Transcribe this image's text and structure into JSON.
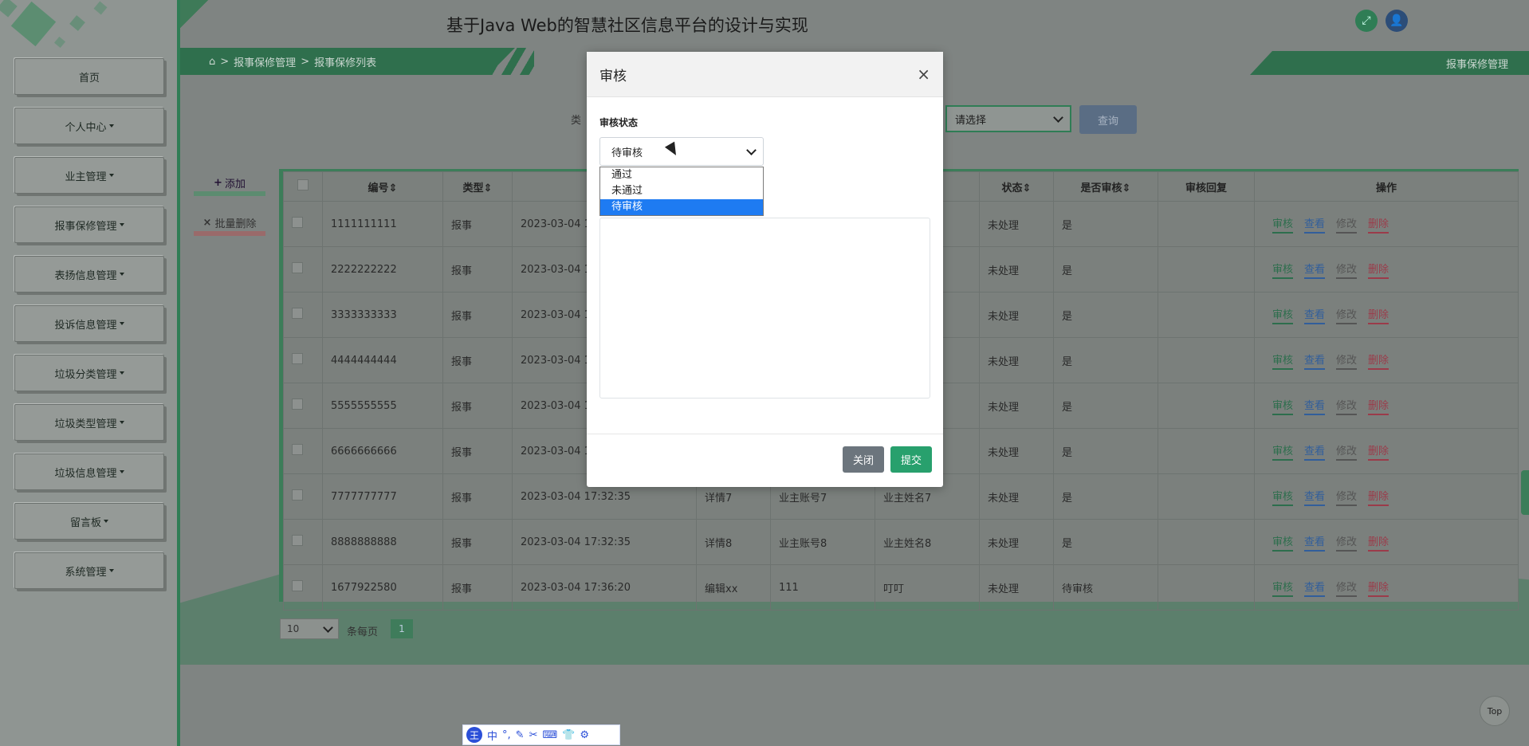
{
  "app": {
    "title": "基于Java Web的智慧社区信息平台的设计与实现"
  },
  "sidebar": {
    "items": [
      {
        "label": "首页",
        "has_caret": false
      },
      {
        "label": "个人中心",
        "has_caret": true
      },
      {
        "label": "业主管理",
        "has_caret": true
      },
      {
        "label": "报事保修管理",
        "has_caret": true
      },
      {
        "label": "表扬信息管理",
        "has_caret": true
      },
      {
        "label": "投诉信息管理",
        "has_caret": true
      },
      {
        "label": "垃圾分类管理",
        "has_caret": true
      },
      {
        "label": "垃圾类型管理",
        "has_caret": true
      },
      {
        "label": "垃圾信息管理",
        "has_caret": true
      },
      {
        "label": "留言板",
        "has_caret": true
      },
      {
        "label": "系统管理",
        "has_caret": true
      }
    ]
  },
  "breadcrumb": {
    "home_icon": "home-icon",
    "items": [
      "报事保修管理",
      "报事保修列表"
    ],
    "separator": ">"
  },
  "right_tab": "报事保修管理",
  "search": {
    "label": "类",
    "select_value": "请选择",
    "query_label": "查询"
  },
  "actions": {
    "add_label": "添加",
    "batch_delete_label": "批量删除"
  },
  "table": {
    "headers": [
      "编号",
      "类型",
      "",
      "",
      "",
      "",
      "状态",
      "是否审核",
      "审核回复",
      "操作"
    ],
    "rows": [
      {
        "id": "1111111111",
        "type": "报事",
        "time": "2023-03-04 17:",
        "detail": "",
        "account": "",
        "name": "",
        "status": "未处理",
        "audited": "是"
      },
      {
        "id": "2222222222",
        "type": "报事",
        "time": "2023-03-04 17:",
        "detail": "",
        "account": "",
        "name": "",
        "status": "未处理",
        "audited": "是"
      },
      {
        "id": "3333333333",
        "type": "报事",
        "time": "2023-03-04 17:",
        "detail": "",
        "account": "",
        "name": "",
        "status": "未处理",
        "audited": "是"
      },
      {
        "id": "4444444444",
        "type": "报事",
        "time": "2023-03-04 17:",
        "detail": "",
        "account": "",
        "name": "",
        "status": "未处理",
        "audited": "是"
      },
      {
        "id": "5555555555",
        "type": "报事",
        "time": "2023-03-04 17:",
        "detail": "",
        "account": "",
        "name": "",
        "status": "未处理",
        "audited": "是"
      },
      {
        "id": "6666666666",
        "type": "报事",
        "time": "2023-03-04 17:",
        "detail": "",
        "account": "",
        "name": "",
        "status": "未处理",
        "audited": "是"
      },
      {
        "id": "7777777777",
        "type": "报事",
        "time": "2023-03-04 17:32:35",
        "detail": "详情7",
        "account": "业主账号7",
        "name": "业主姓名7",
        "status": "未处理",
        "audited": "是"
      },
      {
        "id": "8888888888",
        "type": "报事",
        "time": "2023-03-04 17:32:35",
        "detail": "详情8",
        "account": "业主账号8",
        "name": "业主姓名8",
        "status": "未处理",
        "audited": "是"
      },
      {
        "id": "1677922580",
        "type": "报事",
        "time": "2023-03-04 17:36:20",
        "detail": "编辑xx",
        "account": "111",
        "name": "叮叮",
        "status": "未处理",
        "audited": "待审核"
      }
    ],
    "row_actions": [
      "审核",
      "查看",
      "修改",
      "删除"
    ]
  },
  "pagination": {
    "page_size": "10",
    "per_page_text": "条每页",
    "current_page": "1"
  },
  "top_button": "Top",
  "ime": {
    "logo": "王",
    "mode": "中"
  },
  "modal": {
    "title": "审核",
    "close_icon": "×",
    "status_label": "审核状态",
    "status_value": "待审核",
    "options": [
      "通过",
      "未通过",
      "待审核"
    ],
    "selected_option_index": 2,
    "close_button": "关闭",
    "submit_button": "提交"
  }
}
